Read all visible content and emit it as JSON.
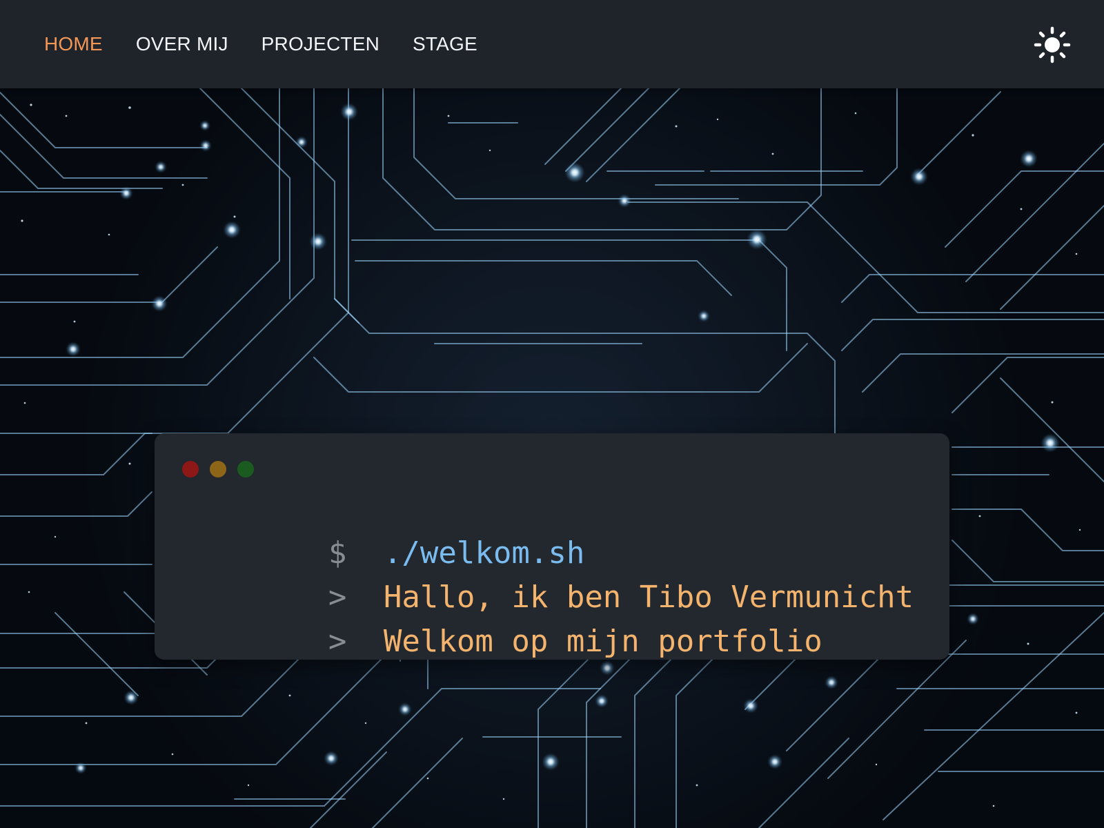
{
  "navbar": {
    "items": [
      {
        "label": "HOME",
        "active": true
      },
      {
        "label": "OVER MIJ",
        "active": false
      },
      {
        "label": "PROJECTEN",
        "active": false
      },
      {
        "label": "STAGE",
        "active": false
      }
    ],
    "theme_toggle_icon": "sun-icon"
  },
  "terminal": {
    "window_controls": [
      "close",
      "minimize",
      "maximize"
    ],
    "control_colors": [
      "#8e1717",
      "#8c6519",
      "#1c5b1f"
    ],
    "prompt_symbol": "$",
    "output_symbol": ">",
    "command": "./welkom.sh",
    "output_lines": [
      "Hallo, ik ben Tibo Vermunicht",
      "Welkom op mijn portfolio"
    ]
  },
  "colors": {
    "accent": "#f49654",
    "nav_bg": "#1f242b",
    "terminal_bg": "#23272e",
    "command": "#7bbcf0",
    "output": "#f5b46d"
  }
}
